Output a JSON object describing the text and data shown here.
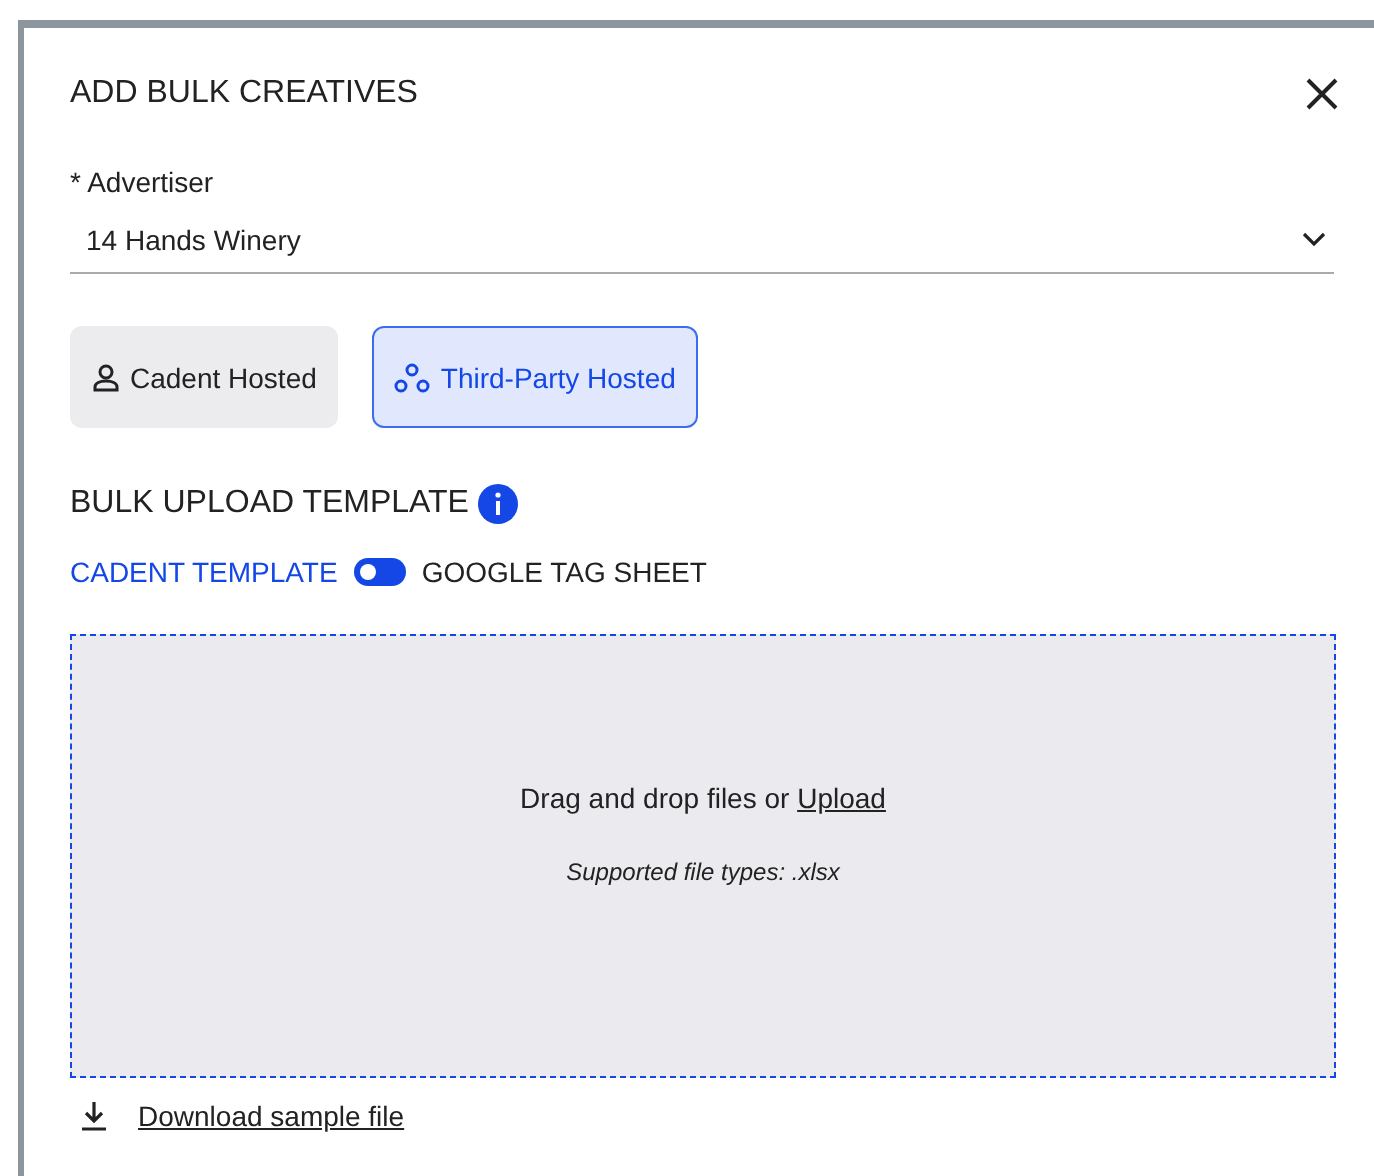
{
  "dialog": {
    "title": "ADD BULK CREATIVES"
  },
  "advertiser": {
    "label": "* Advertiser",
    "value": "14 Hands Winery"
  },
  "hosting_options": [
    {
      "label": "Cadent Hosted",
      "selected": false
    },
    {
      "label": "Third-Party Hosted",
      "selected": true
    }
  ],
  "template": {
    "heading": "BULK UPLOAD TEMPLATE",
    "left_label": "CADENT TEMPLATE",
    "right_label": "GOOGLE TAG SHEET",
    "on": false
  },
  "dropzone": {
    "text": "Drag and drop files or",
    "link": "Upload",
    "hint": "Supported file types: .xlsx"
  },
  "download_link": "Download sample file"
}
